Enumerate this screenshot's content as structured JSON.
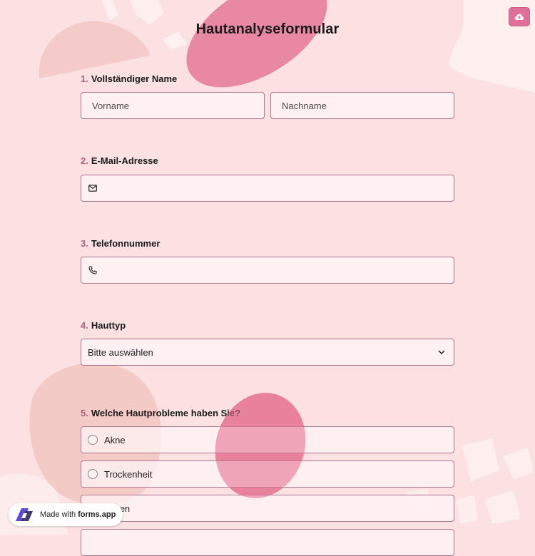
{
  "form": {
    "title": "Hautanalyseformular",
    "upload_icon": "cloud-upload-icon"
  },
  "questions": {
    "q1": {
      "number": "1.",
      "label": "Vollständiger Name",
      "first_placeholder": "Vorname",
      "last_placeholder": "Nachname"
    },
    "q2": {
      "number": "2.",
      "label": "E-Mail-Adresse",
      "icon": "envelope-icon",
      "value": ""
    },
    "q3": {
      "number": "3.",
      "label": "Telefonnummer",
      "icon": "phone-icon",
      "value": ""
    },
    "q4": {
      "number": "4.",
      "label": "Hauttyp",
      "selected": "Bitte auswählen",
      "icon": "chevron-down-icon"
    },
    "q5": {
      "number": "5.",
      "label": "Welche Hautprobleme haben Sie?",
      "options": [
        "Akne",
        "Trockenheit",
        "ungen"
      ]
    }
  },
  "badge": {
    "prefix": "Made with",
    "brand": "forms.app"
  },
  "colors": {
    "background": "#fbe1e2",
    "accent": "#e0709a",
    "border": "#b07590",
    "number": "#b36087"
  }
}
